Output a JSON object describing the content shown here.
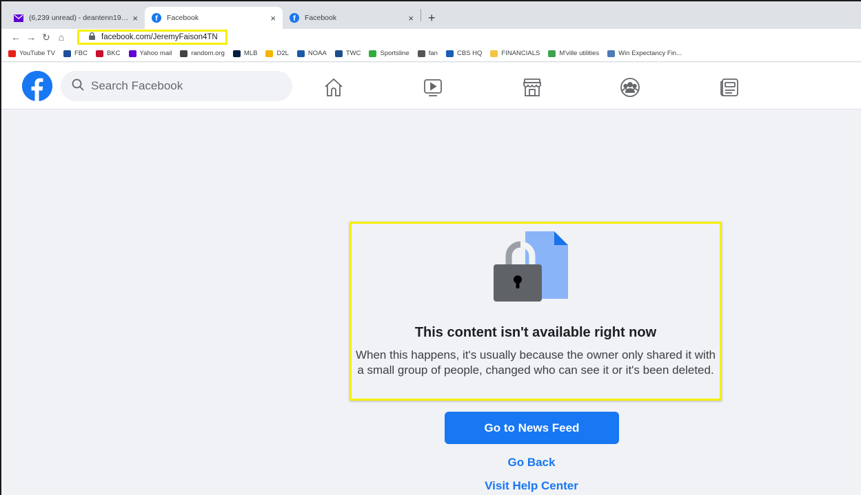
{
  "browser": {
    "tabs": [
      {
        "label": "(6,239 unread) - deantenn1969@",
        "icon": "mail-icon",
        "close": "×"
      },
      {
        "label": "Facebook",
        "icon": "facebook-icon",
        "close": "×"
      },
      {
        "label": "Facebook",
        "icon": "facebook-icon",
        "close": "×"
      }
    ],
    "new_tab": "+",
    "url": "facebook.com/JeremyFaison4TN",
    "bookmarks": [
      {
        "label": "YouTube TV",
        "color": "#e62117"
      },
      {
        "label": "FBC",
        "color": "#1f4e9c"
      },
      {
        "label": "BKC",
        "color": "#c8102e"
      },
      {
        "label": "Yahoo mail",
        "color": "#6001d2"
      },
      {
        "label": "random.org",
        "color": "#444444"
      },
      {
        "label": "MLB",
        "color": "#041e42"
      },
      {
        "label": "D2L",
        "color": "#f4b400"
      },
      {
        "label": "NOAA",
        "color": "#1c5aa8"
      },
      {
        "label": "TWC",
        "color": "#1d4e89"
      },
      {
        "label": "Sportsline",
        "color": "#2fae3a"
      },
      {
        "label": "fan",
        "color": "#555555"
      },
      {
        "label": "CBS HQ",
        "color": "#1a5fb4"
      },
      {
        "label": "FINANCIALS",
        "color": "#f6c343"
      },
      {
        "label": "M'ville utilities",
        "color": "#3fa34d"
      },
      {
        "label": "Win Expectancy Fin...",
        "color": "#4e7ab5"
      }
    ]
  },
  "header": {
    "search_placeholder": "Search Facebook",
    "nav_icons": [
      "home-icon",
      "watch-icon",
      "marketplace-icon",
      "groups-icon",
      "news-icon"
    ]
  },
  "content": {
    "title": "This content isn't available right now",
    "description": "When this happens, it's usually because the owner only shared it with a small group of people, changed who can see it or it's been deleted.",
    "primary_button": "Go to News Feed",
    "links": [
      "Go Back",
      "Visit Help Center"
    ]
  },
  "colors": {
    "facebook_blue": "#1877f2",
    "highlight_yellow": "#f5f000",
    "background": "#f0f2f5"
  }
}
